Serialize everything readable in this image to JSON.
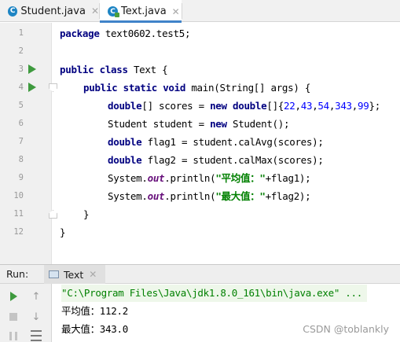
{
  "tabs": [
    {
      "label": "Student.java",
      "icon": "class-icon",
      "active": false
    },
    {
      "label": "Text.java",
      "icon": "class-icon",
      "active": true
    }
  ],
  "editor": {
    "lines": [
      {
        "n": "1"
      },
      {
        "n": "2"
      },
      {
        "n": "3"
      },
      {
        "n": "4"
      },
      {
        "n": "5"
      },
      {
        "n": "6"
      },
      {
        "n": "7"
      },
      {
        "n": "8"
      },
      {
        "n": "9"
      },
      {
        "n": "10"
      },
      {
        "n": "11"
      },
      {
        "n": "12"
      }
    ],
    "code": {
      "l1_kw": "package",
      "l1_rest": " text0602.test5;",
      "l3_kw1": "public",
      "l3_kw2": "class",
      "l3_rest": " Text {",
      "l4_kw1": "public",
      "l4_kw2": "static",
      "l4_kw3": "void",
      "l4_rest": " main(String[] args) {",
      "l5_kw1": "double",
      "l5_mid": "[] scores = ",
      "l5_kw2": "new",
      "l5_kw3": "double",
      "l5_open": "[]{",
      "l5_n1": "22",
      "l5_n2": "43",
      "l5_n3": "54",
      "l5_n4": "343",
      "l5_n5": "99",
      "l5_close": "};",
      "l6_pre": "Student student = ",
      "l6_kw": "new",
      "l6_rest": " Student();",
      "l7_kw": "double",
      "l7_rest": " flag1 = student.calAvg(scores);",
      "l8_kw": "double",
      "l8_rest": " flag2 = student.calMax(scores);",
      "l9_pre": "System.",
      "l9_fld": "out",
      "l9_mid": ".println(",
      "l9_str": "\"平均值：\"",
      "l9_rest": "+flag1);",
      "l10_pre": "System.",
      "l10_fld": "out",
      "l10_mid": ".println(",
      "l10_str": "\"最大值：\"",
      "l10_rest": "+flag2);",
      "l11": "}",
      "l12": "}"
    }
  },
  "run": {
    "label": "Run:",
    "tab_label": "Text",
    "console": {
      "path": "\"C:\\Program Files\\Java\\jdk1.8.0_161\\bin\\java.exe\" ...",
      "line1": "平均值：112.2",
      "line2": "最大值：343.0"
    }
  },
  "watermark": "CSDN @toblankly",
  "colors": {
    "keyword": "#000080",
    "number": "#0000ff",
    "string": "#008000",
    "field": "#660e7a",
    "run_green": "#3e9a3e",
    "tab_underline": "#4083c9"
  }
}
